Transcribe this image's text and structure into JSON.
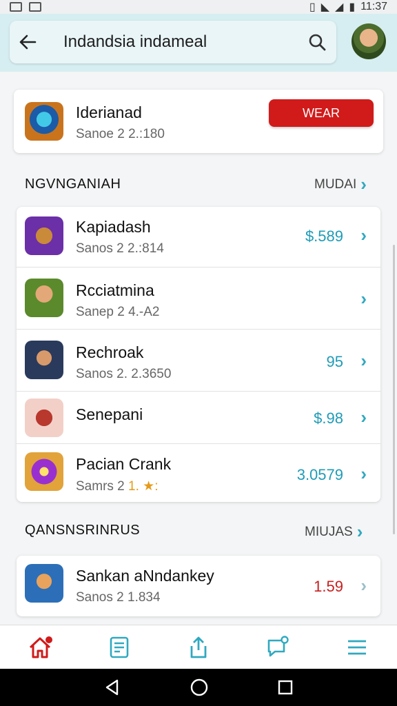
{
  "status_bar": {
    "time": "11:37"
  },
  "search": {
    "query": "Indandsia indameal"
  },
  "featured": {
    "title": "Iderianad",
    "subtitle": "Sanoe 2  2.:180",
    "button_label": "WEAR",
    "icon": "game-icon-blue-orb",
    "button_color": "#d11a1a"
  },
  "section1": {
    "heading": "NGVNGANIAH",
    "more_label": "MUDAI",
    "items": [
      {
        "title": "Kapiadash",
        "subtitle": "Sanos 2  2.:814",
        "price": "$.589",
        "icon": "game-icon-chest"
      },
      {
        "title": "Rcciatmina",
        "subtitle": "Sanep 2  4.-A2",
        "price": "",
        "icon": "game-icon-hero"
      },
      {
        "title": "Rechroak",
        "subtitle": "Sanos 2.  2.3650",
        "price": "95",
        "icon": "game-icon-pirate"
      },
      {
        "title": "Senepani",
        "subtitle": "",
        "price": "$.98",
        "icon": "game-icon-box"
      },
      {
        "title": "Pacian Crank",
        "subtitle": "Samrs 2",
        "rating": "1. ★:",
        "price": "3.0579",
        "icon": "game-icon-orb"
      }
    ]
  },
  "section2": {
    "heading": "QANSNSRINRUS",
    "more_label": "MIUJAS",
    "items": [
      {
        "title": "Sankan aNndankey",
        "subtitle": "Sanos 2  1.834",
        "price": "1.59",
        "icon": "game-icon-warrior",
        "price_color": "#c62020"
      }
    ]
  },
  "bottom_nav": [
    {
      "name": "home-icon",
      "color": "#d11a1a"
    },
    {
      "name": "document-icon",
      "color": "#2fa9c0"
    },
    {
      "name": "share-icon",
      "color": "#2fa9c0"
    },
    {
      "name": "chat-icon",
      "color": "#2fa9c0"
    },
    {
      "name": "menu-icon",
      "color": "#2fa9c0"
    }
  ],
  "colors": {
    "accent": "#2fa9c0",
    "header_bg": "#d6eef1",
    "danger": "#d11a1a"
  }
}
